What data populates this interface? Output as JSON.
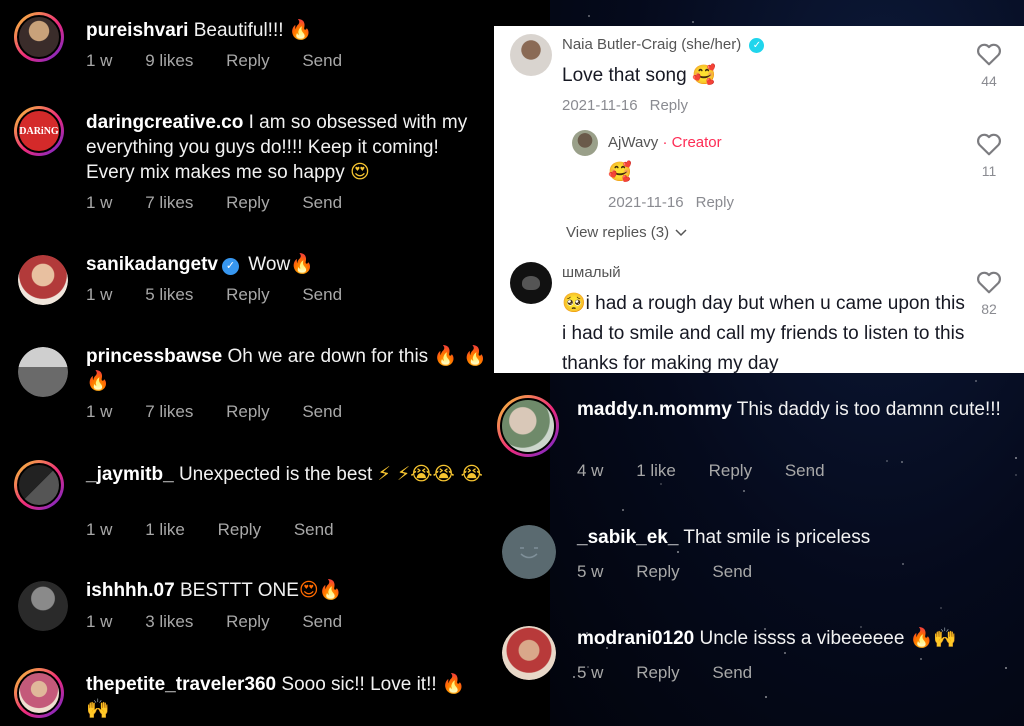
{
  "left_comments": [
    {
      "user": "pureishvari",
      "text": "Beautiful!!!",
      "emoji": "🔥",
      "time": "1 w",
      "likes": "9 likes",
      "reply": "Reply",
      "send": "Send"
    },
    {
      "user": "daringcreative.co",
      "text": "I am so obsessed with my everything you guys do!!!! Keep it coming! Every mix makes me so happy",
      "emoji": "😍",
      "time": "1 w",
      "likes": "7 likes",
      "reply": "Reply",
      "send": "Send",
      "avatar_text": "DARiNG"
    },
    {
      "user": "sanikadangetv",
      "text": "Wow",
      "emoji": "🔥",
      "time": "1 w",
      "likes": "5 likes",
      "reply": "Reply",
      "send": "Send"
    },
    {
      "user": "princessbawse",
      "text": "Oh we are down for this",
      "emoji": "🔥 🔥🔥",
      "time": "1 w",
      "likes": "7 likes",
      "reply": "Reply",
      "send": "Send"
    },
    {
      "user": "_jaymitb_",
      "text": "Unexpected is the best",
      "emoji": "⚡ ⚡😭😭 😭",
      "time": "1 w",
      "likes": "1 like",
      "reply": "Reply",
      "send": "Send"
    },
    {
      "user": "ishhhh.07",
      "text": "BESTTT ONE",
      "emoji": "😍🔥",
      "time": "1 w",
      "likes": "3 likes",
      "reply": "Reply",
      "send": "Send"
    },
    {
      "user": "thepetite_traveler360",
      "text": "Sooo sic!! Love it!!",
      "emoji": "🔥 🙌"
    }
  ],
  "tiktok": {
    "comments": [
      {
        "user": "Naia Butler-Craig (she/her)",
        "text": "Love that song",
        "emoji": "🥰",
        "date": "2021-11-16",
        "reply": "Reply",
        "likes": "44"
      },
      {
        "user": "AjWavy",
        "creator_label": "· Creator",
        "emoji": "🥰",
        "date": "2021-11-16",
        "reply": "Reply",
        "likes": "11"
      },
      {
        "user": "шмалый",
        "emoji": "🥺",
        "text": "i had a rough day but when u came upon this i had to smile and call my friends to listen to this thanks for making my day",
        "likes": "82"
      }
    ],
    "view_replies": "View replies (3)",
    "chevron_icon": "chevron-down-icon"
  },
  "right_comments": [
    {
      "user": "maddy.n.mommy",
      "text": "This daddy is too damnn cute!!!",
      "time": "4 w",
      "likes": "1 like",
      "reply": "Reply",
      "send": "Send"
    },
    {
      "user": "_sabik_ek_",
      "text": "That smile is priceless",
      "time": "5 w",
      "reply": "Reply",
      "send": "Send"
    },
    {
      "user": "modrani0120",
      "text": "Uncle issss a vibeeeeee",
      "emoji": "🔥🙌",
      "time": "5 w",
      "reply": "Reply",
      "send": "Send"
    }
  ],
  "colors": {
    "instagram_bg": "#000000",
    "verified": "#3797f0",
    "creator": "#fe2c55",
    "meta_gray": "#a8a8a8"
  }
}
